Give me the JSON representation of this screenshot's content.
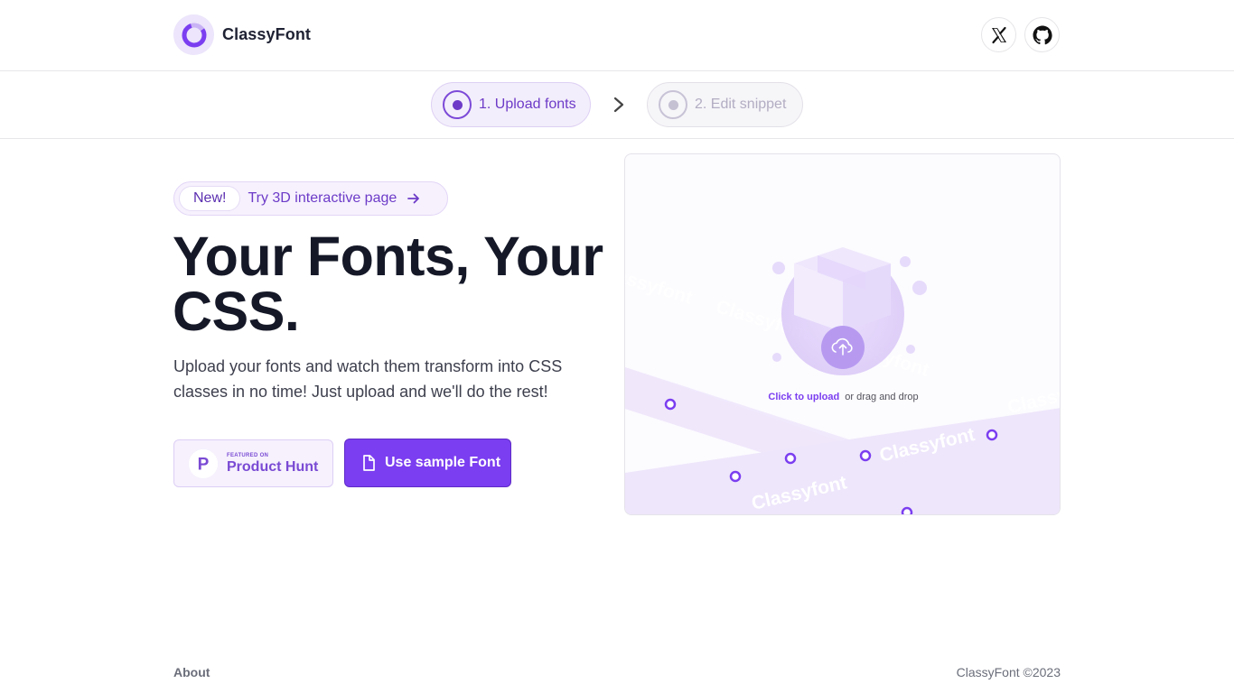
{
  "brand": {
    "name": "ClassyFont"
  },
  "social": {
    "x_label": "X",
    "github_label": "GitHub"
  },
  "stepper": {
    "steps": [
      {
        "label": "1. Upload fonts",
        "state": "active"
      },
      {
        "label": "2. Edit snippet",
        "state": "inactive"
      }
    ]
  },
  "hero": {
    "badge_tag": "New!",
    "badge_text": "Try 3D interactive page",
    "title_line1": "Your Fonts, Your",
    "title_line2": "CSS.",
    "subtitle": "Upload your fonts and watch them transform into CSS classes in no time! Just upload and we'll do the rest!"
  },
  "actions": {
    "product_hunt_small": "FEATURED ON",
    "product_hunt_big": "Product Hunt",
    "product_hunt_letter": "P",
    "sample_label": "Use sample Font"
  },
  "upload": {
    "cta": "Click to upload",
    "hint": "or drag and drop",
    "ribbon_text": "Classyfont"
  },
  "footer": {
    "about": "About",
    "copyright": "ClassyFont ©2023"
  },
  "colors": {
    "accent": "#7b3ef0",
    "accent_dark": "#6d3bc8",
    "text_dark": "#151827"
  },
  "icons": [
    "brand-ring-icon",
    "x-logo-icon",
    "github-icon",
    "chevron-right-icon",
    "arrow-right-icon",
    "file-icon",
    "product-hunt-icon",
    "cloud-upload-icon",
    "box-icon"
  ]
}
